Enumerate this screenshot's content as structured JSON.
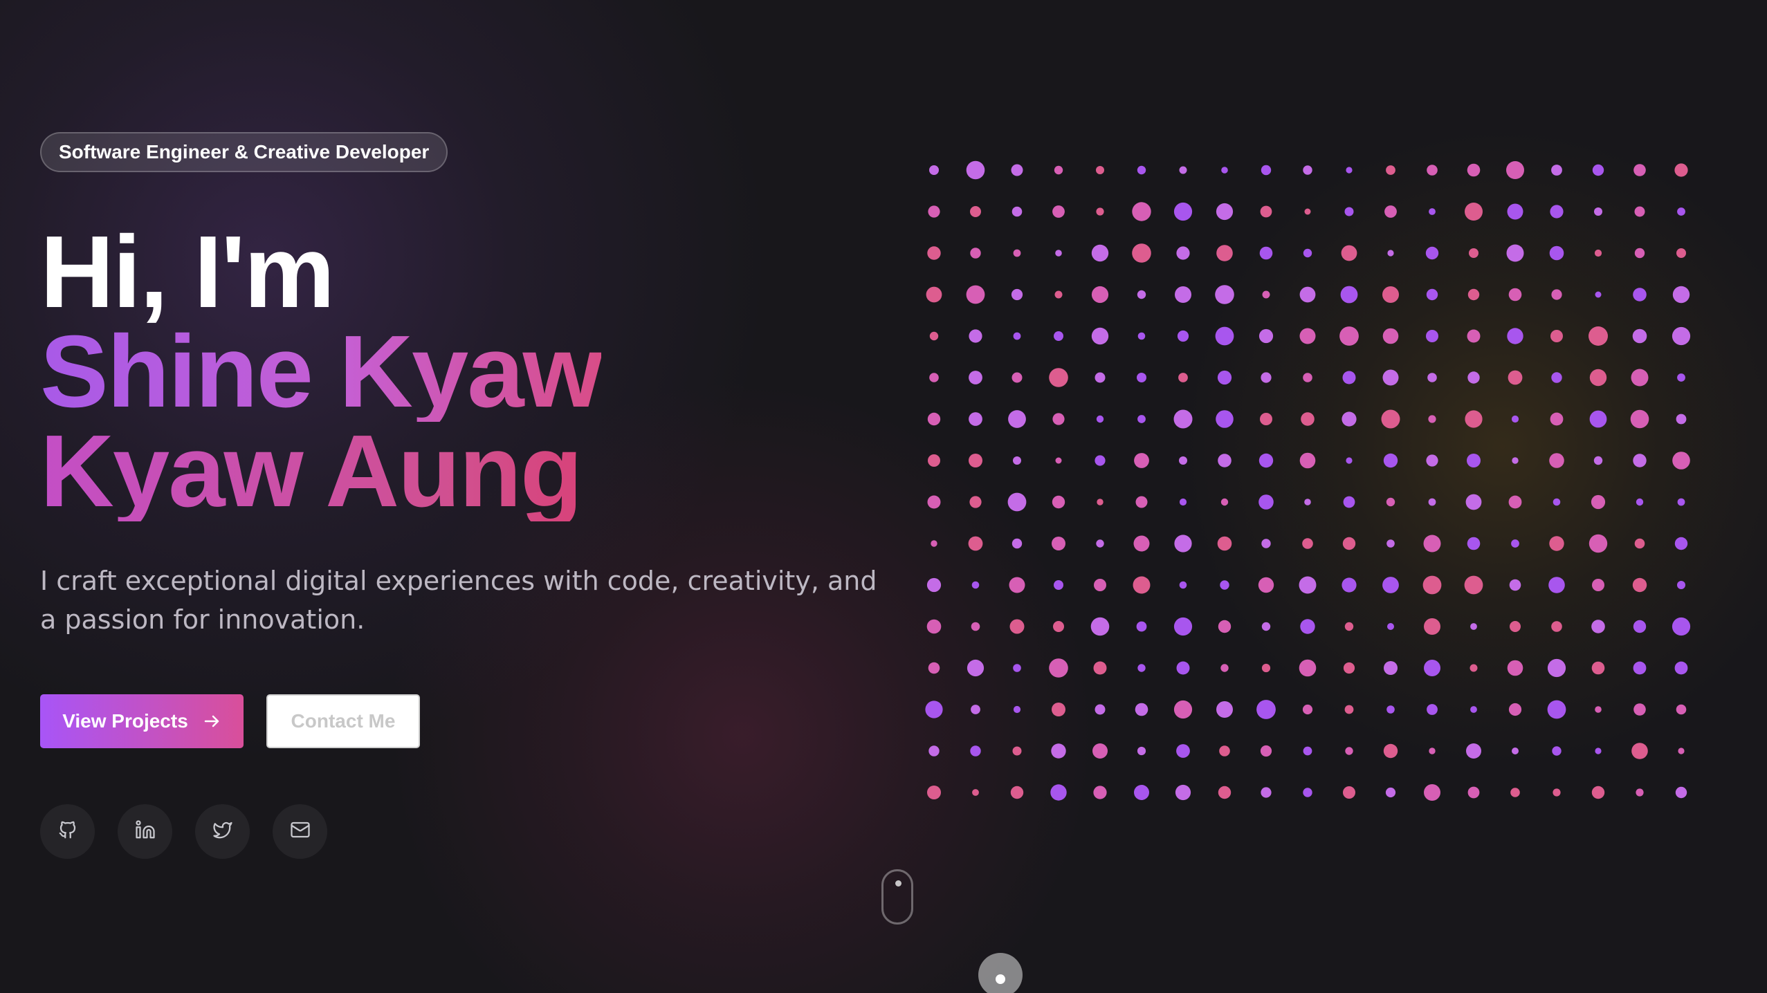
{
  "hero": {
    "badge": "Software Engineer & Creative Developer",
    "title_line_1": "Hi, I'm",
    "title_line_2": "Shine Kyaw",
    "title_line_3": "Kyaw Aung",
    "subtitle": "I craft exceptional digital experiences with code, creativity, and a passion for innovation."
  },
  "buttons": {
    "primary": "View Projects",
    "secondary": "Contact Me"
  },
  "socials": [
    {
      "name": "github-icon"
    },
    {
      "name": "linkedin-icon"
    },
    {
      "name": "twitter-icon"
    },
    {
      "name": "mail-icon"
    }
  ],
  "dot_grid": {
    "rows": 16,
    "cols": 19,
    "colors": [
      "#c46ce7",
      "#d75fb5",
      "#a856ee",
      "#dd5d8f"
    ]
  },
  "scroll_indicator": {
    "icon": "mouse-scroll-icon"
  },
  "colors": {
    "background": "#18171b",
    "accent_purple": "#a855f7",
    "accent_pink": "#d94f9a"
  }
}
